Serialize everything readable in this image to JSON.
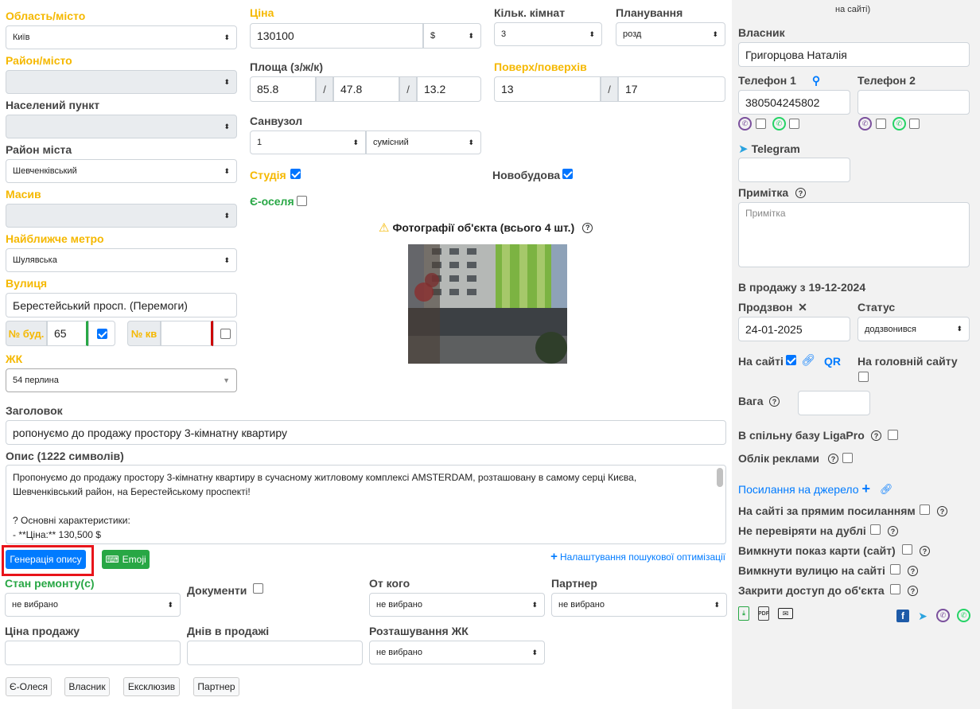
{
  "left": {
    "region_label": "Область/місто",
    "region_value": "Київ",
    "district_label": "Район/місто",
    "settlement_label": "Населений пункт",
    "city_district_label": "Район міста",
    "city_district_value": "Шевченківський",
    "massif_label": "Масив",
    "metro_label": "Найближче метро",
    "metro_value": "Шулявська",
    "street_label": "Вулиця",
    "street_value": "Берестейський просп. (Перемоги)",
    "building_label": "№ буд.",
    "building_value": "65",
    "apt_label": "№ кв",
    "complex_label": "ЖК",
    "complex_value": "54 перлина"
  },
  "middle": {
    "price_label": "Ціна",
    "price_value": "130100",
    "currency_value": "$",
    "area_label": "Площа (з/ж/к)",
    "area_total": "85.8",
    "area_living": "47.8",
    "area_kitchen": "13.2",
    "slash": "/",
    "bathroom_label": "Санвузол",
    "bathroom_count": "1",
    "bathroom_type": "сумісний",
    "studio_label": "Студія",
    "eoselia_label": "Є-оселя",
    "photos_title": "Фотографії об'єкта (всього 4 шт.)",
    "rooms_label": "Кільк. кімнат",
    "rooms_value": "3",
    "layout_label": "Планування",
    "layout_value": "розд",
    "floor_label": "Поверх/поверхів",
    "floor_value": "13",
    "floors_total": "17",
    "newbuild_label": "Новобудова"
  },
  "description": {
    "title_label": "Заголовок",
    "title_value": "ропонуємо до продажу простору 3-кімнатну квартиру",
    "desc_label": "Опис (1222 символів)",
    "desc_line1": "Пропонуємо до продажу простору 3-кімнатну квартиру в сучасному житловому комплексі AMSTERDAM, розташовану в самому серці Києва,",
    "desc_line2": "Шевченківський район, на Берестейському проспекті!",
    "desc_line3": "? Основні характеристики:",
    "desc_line4": "- **Ціна:** 130,500 $",
    "generate_btn": "Генерація опису",
    "emoji_btn": "Emoji",
    "seo_link": "Налаштування пошукової оптимізації"
  },
  "bottom": {
    "repair_label": "Стан ремонту(с)",
    "repair_value": "не вибрано",
    "docs_label": "Документи",
    "from_label": "От кого",
    "from_value": "не вибрано",
    "partner_label": "Партнер",
    "partner_value": "не вибрано",
    "sale_price_label": "Ціна продажу",
    "days_label": "Днів в продажі",
    "location_label": "Розташування ЖК",
    "location_value": "не вибрано",
    "tags": [
      "Є-Олеся",
      "Власник",
      "Ексклюзив",
      "Партнер"
    ]
  },
  "right": {
    "top_text": "на сайті)",
    "owner_label": "Власник",
    "owner_value": "Григорцова Наталія",
    "phone1_label": "Телефон 1",
    "phone1_value": "380504245802",
    "phone2_label": "Телефон 2",
    "telegram_label": "Telegram",
    "note_label": "Примітка",
    "note_placeholder": "Примітка",
    "on_sale_text": "В продажу з 19-12-2024",
    "call_label": "Продзвон",
    "call_value": "24-01-2025",
    "status_label": "Статус",
    "status_value": "додзвонився",
    "on_site_label": "На сайті",
    "qr_label": "QR",
    "main_page_label": "На головній сайту",
    "weight_label": "Вага",
    "ligapro_label": "В спільну базу LigaPro",
    "ads_label": "Облік реклами",
    "source_link": "Посилання на джерело",
    "direct_link_label": "На сайті за прямим посиланням",
    "no_dup_label": "Не перевіряти на дублі",
    "no_map_label": "Вимкнути показ карти (сайт)",
    "no_street_label": "Вимкнути вулицю на сайті",
    "close_access_label": "Закрити доступ до об'єкта"
  },
  "colors": {
    "yellow_label": "#f5b800",
    "green_label": "#28a745",
    "primary": "#007bff",
    "highlight_red": "#e8141a"
  }
}
